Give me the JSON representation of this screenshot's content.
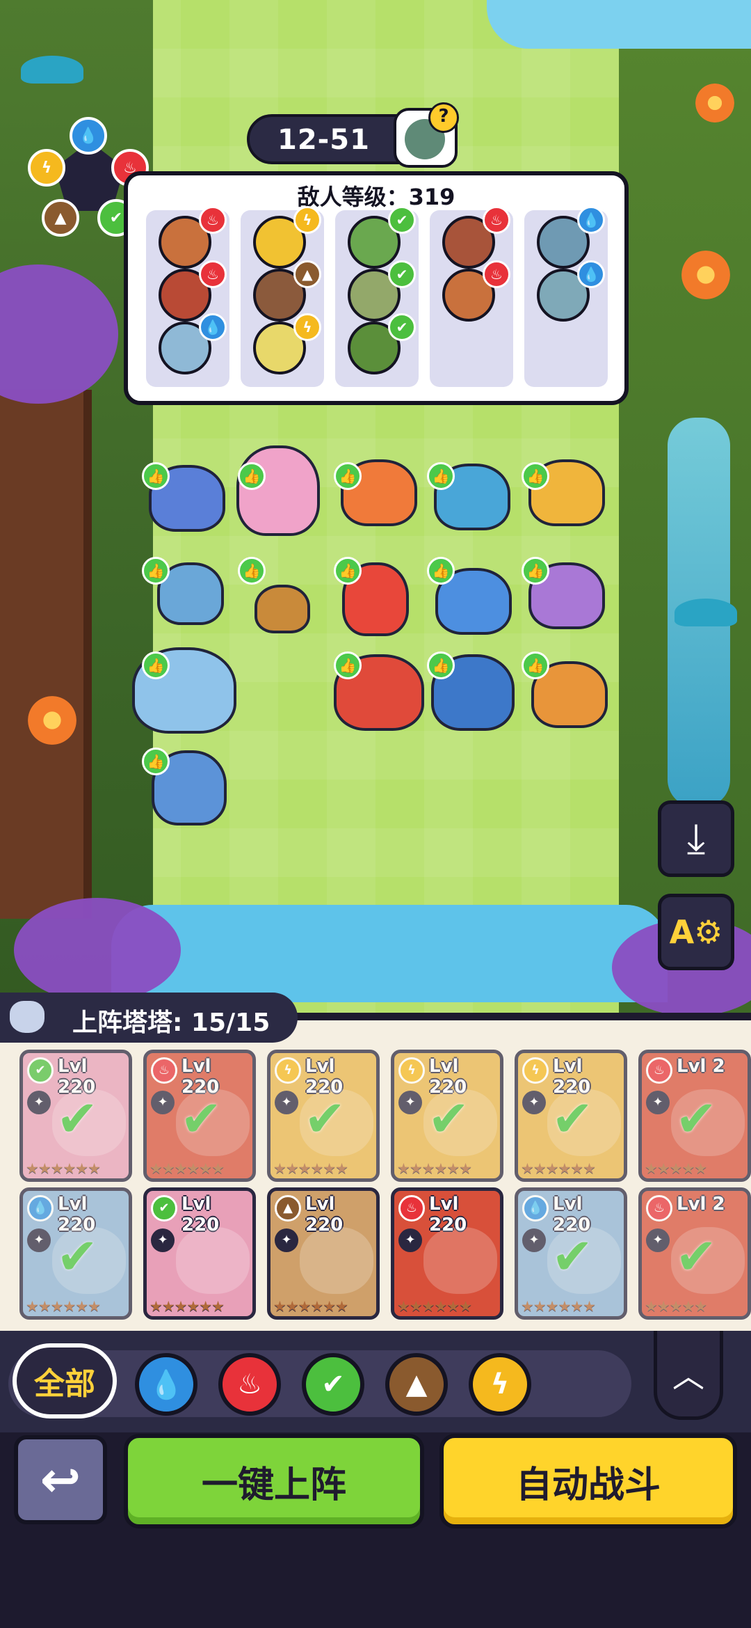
{
  "stage": {
    "label": "12-51"
  },
  "enemy_panel": {
    "title": "敌人等级：319",
    "columns": [
      {
        "enemies": [
          {
            "element": "fire"
          },
          {
            "element": "fire"
          },
          {
            "element": "water"
          }
        ]
      },
      {
        "enemies": [
          {
            "element": "electric"
          },
          {
            "element": "earth"
          },
          {
            "element": "electric"
          }
        ]
      },
      {
        "enemies": [
          {
            "element": "grass"
          },
          {
            "element": "grass"
          },
          {
            "element": "grass"
          }
        ]
      },
      {
        "enemies": [
          {
            "element": "fire"
          },
          {
            "element": "fire"
          }
        ]
      },
      {
        "enemies": [
          {
            "element": "water"
          },
          {
            "element": "water"
          }
        ]
      }
    ]
  },
  "roster": {
    "label": "上阵塔塔: 15/15",
    "cards": [
      {
        "level": "Lvl 220",
        "element": "grass",
        "selected": true,
        "stars": 6
      },
      {
        "level": "Lvl 220",
        "element": "fire",
        "selected": true,
        "stars": 6
      },
      {
        "level": "Lvl 220",
        "element": "electric",
        "selected": true,
        "stars": 6
      },
      {
        "level": "Lvl 220",
        "element": "electric",
        "selected": true,
        "stars": 6
      },
      {
        "level": "Lvl 220",
        "element": "electric",
        "selected": true,
        "stars": 6
      },
      {
        "level": "Lvl 2",
        "element": "fire",
        "selected": true,
        "stars": 5
      },
      {
        "level": "Lvl 220",
        "element": "water",
        "selected": true,
        "stars": 6
      },
      {
        "level": "Lvl 220",
        "element": "grass",
        "selected": false,
        "stars": 6
      },
      {
        "level": "Lvl 220",
        "element": "earth",
        "selected": false,
        "stars": 6
      },
      {
        "level": "Lvl 220",
        "element": "fire",
        "selected": false,
        "stars": 6
      },
      {
        "level": "Lvl 220",
        "element": "water",
        "selected": true,
        "stars": 6
      },
      {
        "level": "Lvl 2",
        "element": "fire",
        "selected": true,
        "stars": 5
      }
    ]
  },
  "filters": {
    "all_label": "全部",
    "elements": [
      "water",
      "fire",
      "grass",
      "earth",
      "electric"
    ]
  },
  "actions": {
    "deploy_label": "一键上阵",
    "auto_battle_label": "自动战斗"
  },
  "colors": {
    "water": "#2f8fe0",
    "fire": "#e8323a",
    "grass": "#4cbf3e",
    "earth": "#8a5a2e",
    "electric": "#f5b91e",
    "like_badge": "#4cc94a",
    "deploy_button": "#7ed43a",
    "auto_button": "#ffd42b"
  },
  "icons": {
    "water": "water-drop-icon",
    "fire": "flame-icon",
    "grass": "leaf-icon",
    "earth": "mountain-icon",
    "electric": "lightning-icon",
    "save_team": "download-icon",
    "auto_settings": "auto-gear-icon",
    "back": "return-arrow-icon",
    "collapse": "chevron-up-icon"
  }
}
